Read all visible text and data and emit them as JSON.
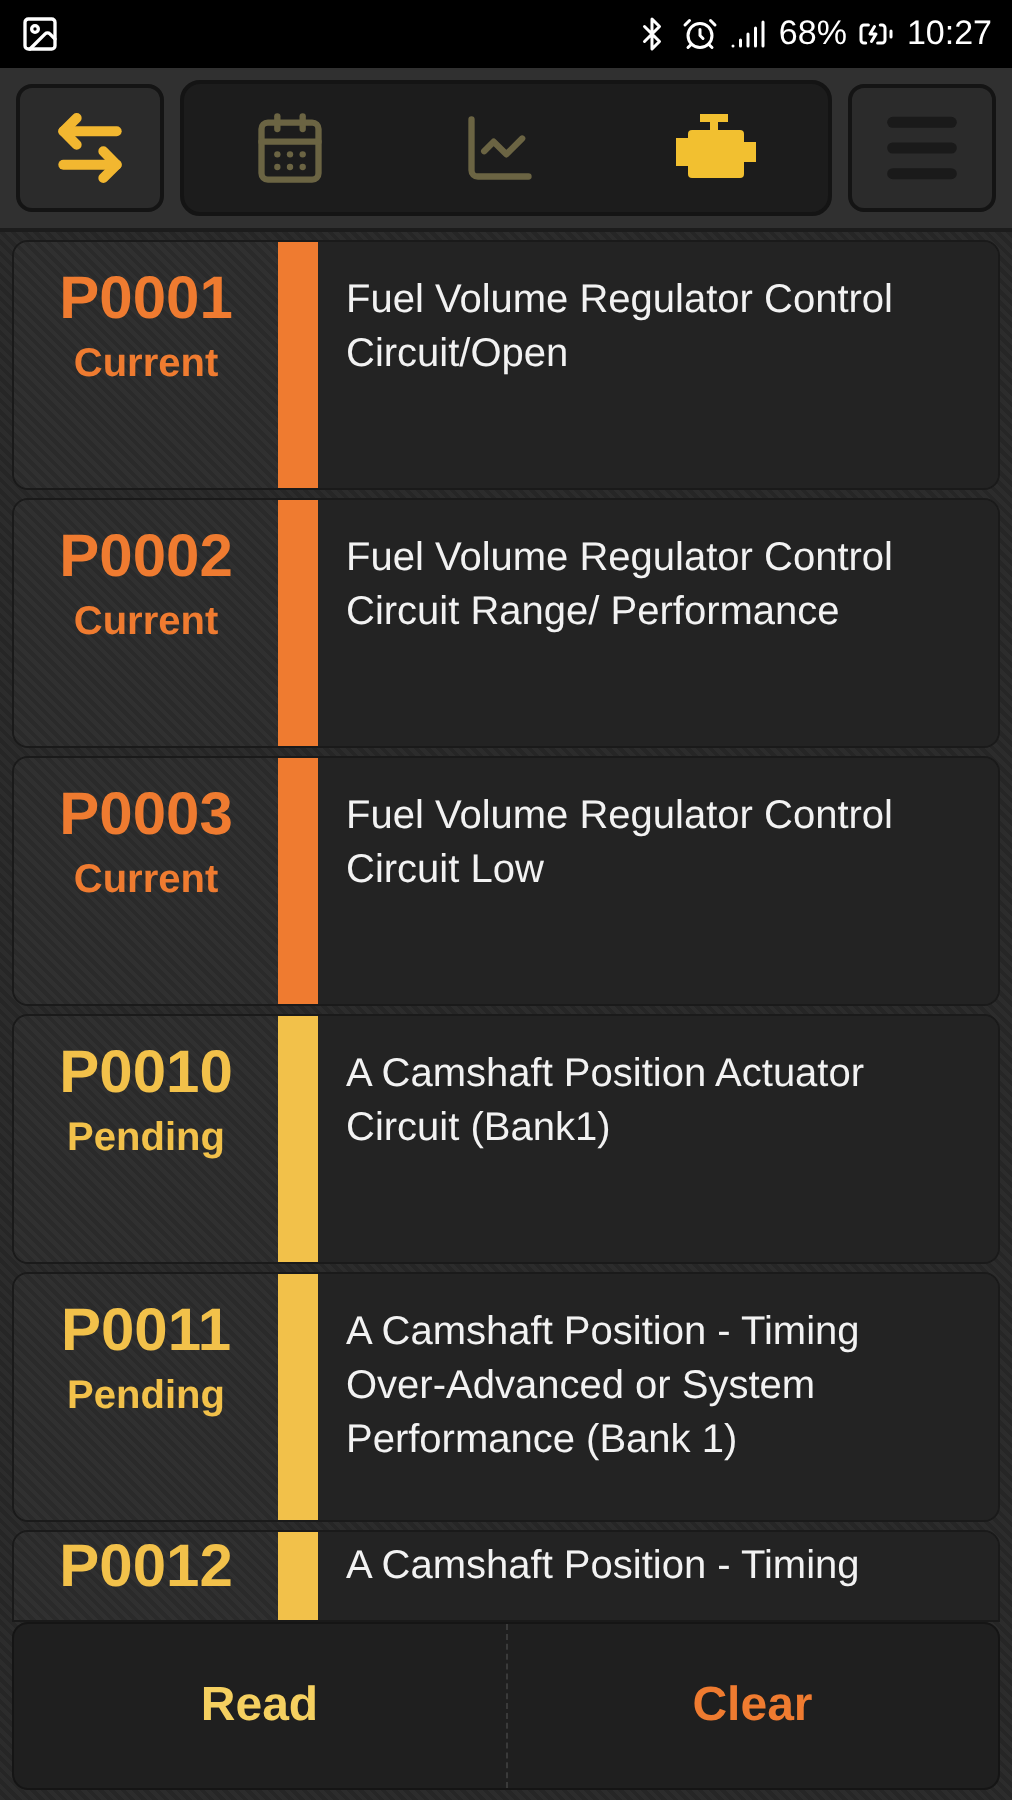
{
  "status_bar": {
    "battery": "68%",
    "time": "10:27"
  },
  "toolbar": {
    "tabs": [
      {
        "selected": false
      },
      {
        "selected": false
      },
      {
        "selected": true
      }
    ]
  },
  "codes": [
    {
      "code": "P0001",
      "status": "Current",
      "kind": "current",
      "description": "Fuel Volume Regulator Control Circuit/Open"
    },
    {
      "code": "P0002",
      "status": "Current",
      "kind": "current",
      "description": "Fuel Volume Regulator Control Circuit Range/ Performance"
    },
    {
      "code": "P0003",
      "status": "Current",
      "kind": "current",
      "description": "Fuel Volume Regulator Control Circuit Low"
    },
    {
      "code": "P0010",
      "status": "Pending",
      "kind": "pending",
      "description": "A Camshaft Position Actuator Circuit (Bank1)"
    },
    {
      "code": "P0011",
      "status": "Pending",
      "kind": "pending",
      "description": "A Camshaft Position - Timing Over-Advanced or System Performance (Bank 1)"
    },
    {
      "code": "P0012",
      "kind": "pending",
      "description": "A Camshaft Position - Timing"
    }
  ],
  "buttons": [
    {
      "label": "Read",
      "kind": "read"
    },
    {
      "label": "Clear",
      "kind": "clear"
    }
  ]
}
